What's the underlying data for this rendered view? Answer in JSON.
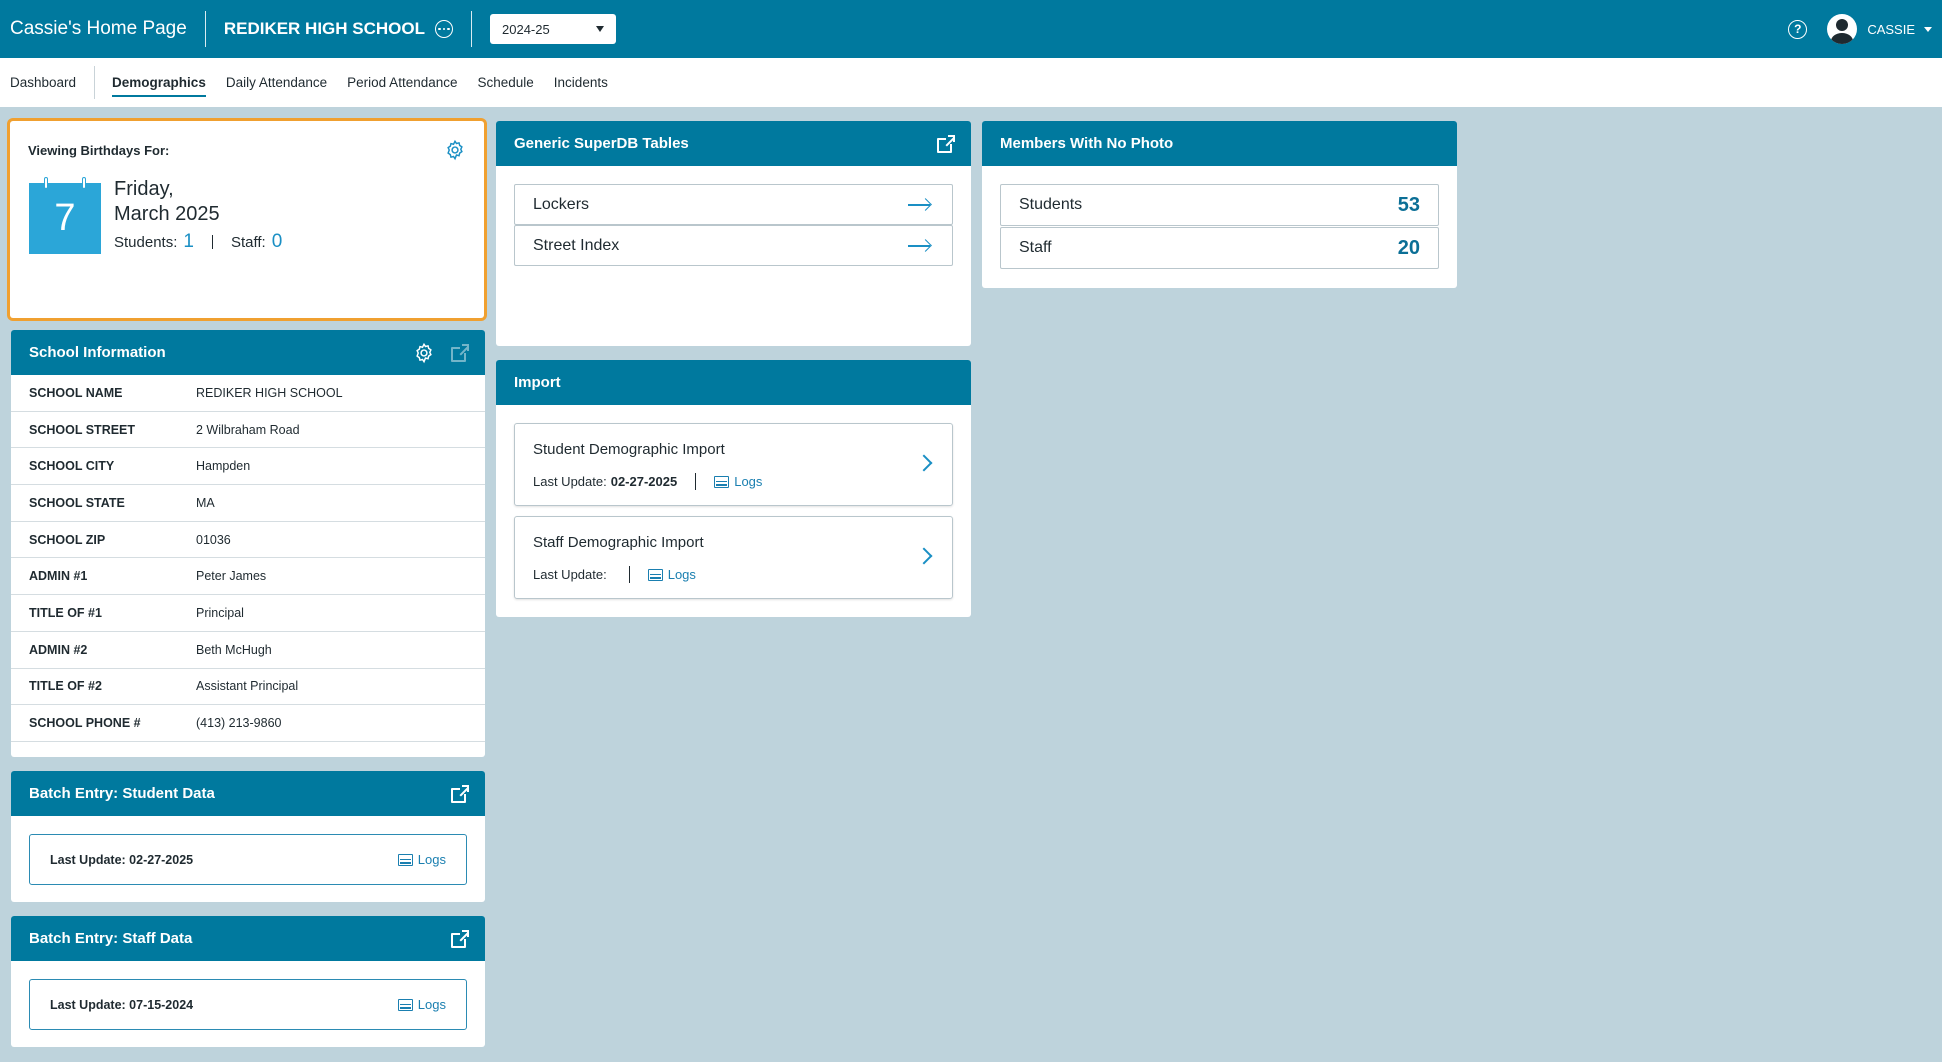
{
  "topbar": {
    "home_title": "Cassie's Home Page",
    "school_name": "REDIKER HIGH SCHOOL",
    "year": "2024-25",
    "user": "CASSIE",
    "help_symbol": "?"
  },
  "nav": {
    "items": [
      "Dashboard",
      "Demographics",
      "Daily Attendance",
      "Period Attendance",
      "Schedule",
      "Incidents"
    ],
    "active": "Demographics"
  },
  "birthday": {
    "label": "Viewing Birthdays For:",
    "day_number": "7",
    "weekday": "Friday,",
    "month_year": "March 2025",
    "students_label": "Students:",
    "students_count": "1",
    "staff_label": "Staff:",
    "staff_count": "0"
  },
  "school_info": {
    "title": "School Information",
    "rows": [
      {
        "key": "SCHOOL NAME",
        "value": "REDIKER HIGH SCHOOL"
      },
      {
        "key": "SCHOOL STREET",
        "value": "2 Wilbraham Road"
      },
      {
        "key": "SCHOOL CITY",
        "value": "Hampden"
      },
      {
        "key": "SCHOOL STATE",
        "value": "MA"
      },
      {
        "key": "SCHOOL ZIP",
        "value": "01036"
      },
      {
        "key": "ADMIN #1",
        "value": "Peter James"
      },
      {
        "key": "TITLE OF #1",
        "value": "Principal"
      },
      {
        "key": "ADMIN #2",
        "value": "Beth McHugh"
      },
      {
        "key": "TITLE OF #2",
        "value": "Assistant Principal"
      },
      {
        "key": "SCHOOL PHONE #",
        "value": "(413) 213-9860"
      }
    ]
  },
  "batch_student": {
    "title": "Batch Entry: Student Data",
    "last_update": "Last Update: 02-27-2025",
    "logs": "Logs"
  },
  "batch_staff": {
    "title": "Batch Entry: Staff Data",
    "last_update": "Last Update: 07-15-2024",
    "logs": "Logs"
  },
  "superdb": {
    "title": "Generic SuperDB Tables",
    "items": [
      "Lockers",
      "Street Index"
    ]
  },
  "import": {
    "title": "Import",
    "items": [
      {
        "title": "Student Demographic Import",
        "label": "Last Update:",
        "date": "02-27-2025",
        "logs": "Logs"
      },
      {
        "title": "Staff Demographic Import",
        "label": "Last Update:",
        "date": "",
        "logs": "Logs"
      }
    ]
  },
  "nophoto": {
    "title": "Members With No Photo",
    "rows": [
      {
        "label": "Students",
        "count": "53"
      },
      {
        "label": "Staff",
        "count": "20"
      }
    ]
  },
  "colors": {
    "brand": "#00799e",
    "background": "#bed3dc",
    "highlight": "#f0a030",
    "accent": "#1a8fc4"
  }
}
